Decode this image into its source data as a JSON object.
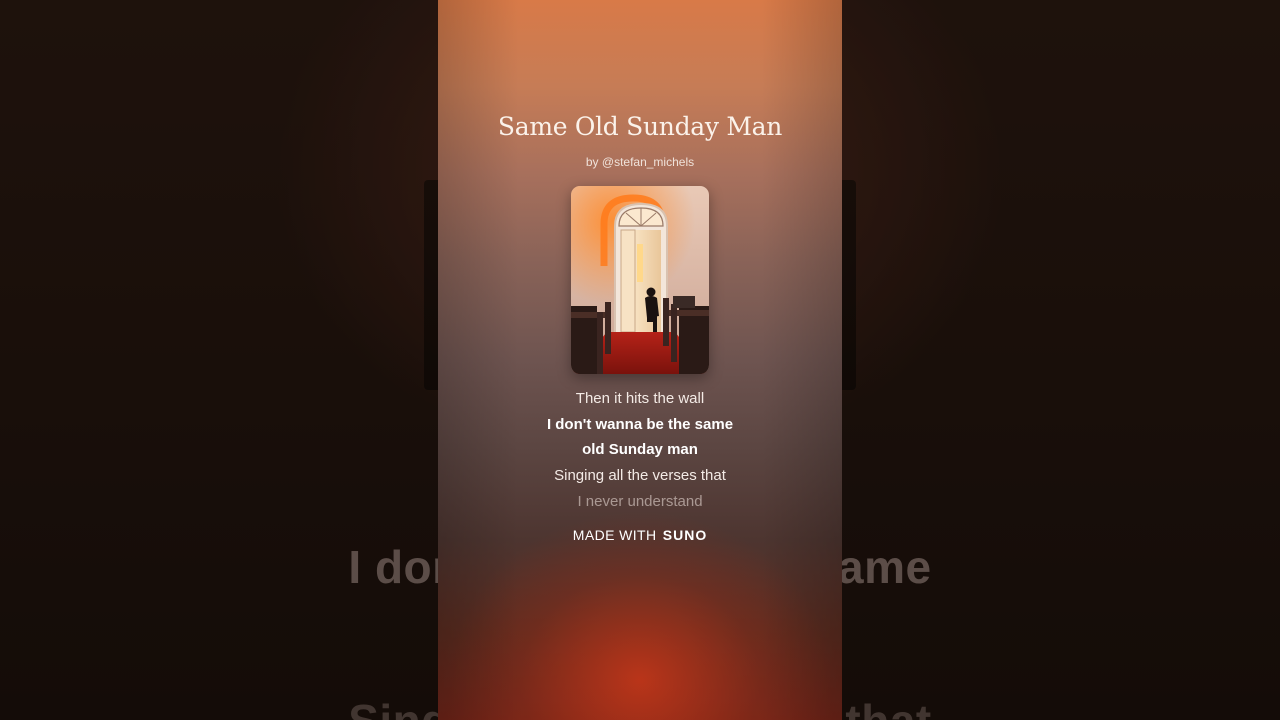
{
  "song": {
    "title": "Same Old Sunday Man",
    "artist": "by @stefan_michels"
  },
  "cover_art": {
    "icon": "album-cover-church-door-image"
  },
  "lyrics": {
    "lines": [
      {
        "text": "Then it hits the wall",
        "state": "normal"
      },
      {
        "text": "I don't wanna be the same",
        "state": "active"
      },
      {
        "text": "old Sunday man",
        "state": "active"
      },
      {
        "text": "Singing all the verses that",
        "state": "normal"
      },
      {
        "text": "I never understand",
        "state": "dim"
      }
    ]
  },
  "watermark": {
    "prefix": "MADE WITH",
    "brand": "SUNO"
  },
  "background": {
    "line_1": "I don't wanna be the same",
    "line_2": "Singing all the verses that"
  },
  "colors": {
    "panel_top": "#d87a48",
    "panel_bottom": "#702418",
    "text": "#ffffff",
    "background": "#1d120e"
  }
}
